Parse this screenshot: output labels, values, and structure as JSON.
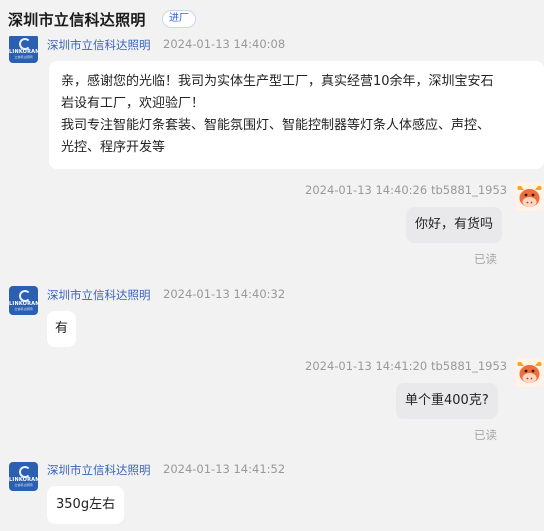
{
  "header": {
    "shop_name": "深圳市立信科达照明",
    "enter_label": "进厂"
  },
  "avatar": {
    "shop_logo_text": "LINKORAN",
    "shop_logo_sub": "立信科达照明"
  },
  "messages": [
    {
      "sender": "深圳市立信科达照明",
      "time": "2024-01-13 14:40:08",
      "lines": [
        "亲，感谢您的光临！我司为实体生产型工厂，真实经营10余年，深圳宝安石",
        "岩设有工厂，欢迎验厂！",
        "我司专注智能灯条套装、智能氛围灯、智能控制器等灯条人体感应、声控、",
        "光控、程序开发等"
      ]
    },
    {
      "sender": "tb5881_1953",
      "time": "2024-01-13 14:40:26",
      "text": "你好，有货吗",
      "status": "已读"
    },
    {
      "sender": "深圳市立信科达照明",
      "time": "2024-01-13 14:40:32",
      "text": "有"
    },
    {
      "sender": "tb5881_1953",
      "time": "2024-01-13 14:41:20",
      "text": "单个重400克?",
      "status": "已读"
    },
    {
      "sender": "深圳市立信科达照明",
      "time": "2024-01-13 14:41:52",
      "text": "350g左右"
    }
  ]
}
